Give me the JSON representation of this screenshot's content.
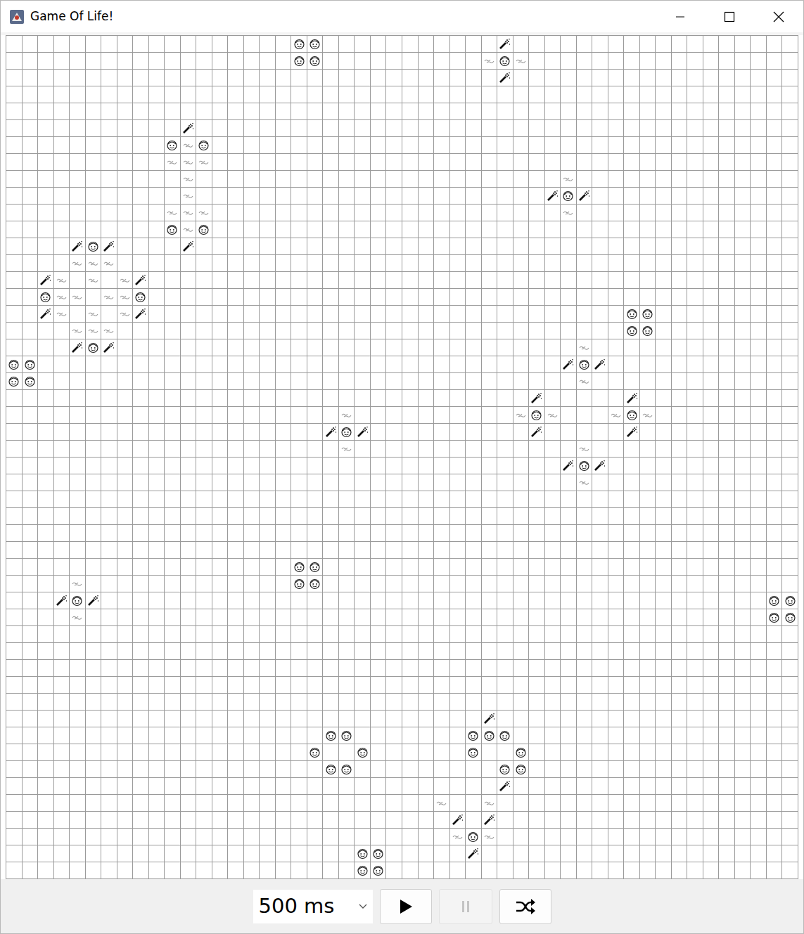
{
  "window": {
    "title": "Game Of Life!"
  },
  "board": {
    "rows": 50,
    "cols": 50,
    "cells": [
      {
        "row": 0,
        "col": 18,
        "kind": "face"
      },
      {
        "row": 0,
        "col": 19,
        "kind": "face"
      },
      {
        "row": 1,
        "col": 18,
        "kind": "face"
      },
      {
        "row": 1,
        "col": 19,
        "kind": "face"
      },
      {
        "row": 0,
        "col": 31,
        "kind": "wand"
      },
      {
        "row": 1,
        "col": 30,
        "kind": "puff"
      },
      {
        "row": 1,
        "col": 31,
        "kind": "face"
      },
      {
        "row": 1,
        "col": 32,
        "kind": "puff"
      },
      {
        "row": 2,
        "col": 31,
        "kind": "wand"
      },
      {
        "row": 5,
        "col": 11,
        "kind": "wand"
      },
      {
        "row": 6,
        "col": 10,
        "kind": "face"
      },
      {
        "row": 6,
        "col": 11,
        "kind": "puff"
      },
      {
        "row": 6,
        "col": 12,
        "kind": "face"
      },
      {
        "row": 7,
        "col": 10,
        "kind": "puff"
      },
      {
        "row": 7,
        "col": 11,
        "kind": "puff"
      },
      {
        "row": 7,
        "col": 12,
        "kind": "puff"
      },
      {
        "row": 8,
        "col": 11,
        "kind": "puff"
      },
      {
        "row": 9,
        "col": 11,
        "kind": "puff"
      },
      {
        "row": 10,
        "col": 10,
        "kind": "puff"
      },
      {
        "row": 10,
        "col": 11,
        "kind": "puff"
      },
      {
        "row": 10,
        "col": 12,
        "kind": "puff"
      },
      {
        "row": 11,
        "col": 10,
        "kind": "face"
      },
      {
        "row": 11,
        "col": 11,
        "kind": "puff"
      },
      {
        "row": 11,
        "col": 12,
        "kind": "face"
      },
      {
        "row": 12,
        "col": 11,
        "kind": "wand"
      },
      {
        "row": 8,
        "col": 35,
        "kind": "puff"
      },
      {
        "row": 9,
        "col": 34,
        "kind": "wand"
      },
      {
        "row": 9,
        "col": 35,
        "kind": "face"
      },
      {
        "row": 9,
        "col": 36,
        "kind": "wand"
      },
      {
        "row": 10,
        "col": 35,
        "kind": "puff"
      },
      {
        "row": 12,
        "col": 4,
        "kind": "wand"
      },
      {
        "row": 12,
        "col": 5,
        "kind": "face"
      },
      {
        "row": 12,
        "col": 6,
        "kind": "wand"
      },
      {
        "row": 13,
        "col": 4,
        "kind": "puff"
      },
      {
        "row": 13,
        "col": 5,
        "kind": "puff"
      },
      {
        "row": 13,
        "col": 6,
        "kind": "puff"
      },
      {
        "row": 14,
        "col": 2,
        "kind": "wand"
      },
      {
        "row": 14,
        "col": 3,
        "kind": "puff"
      },
      {
        "row": 14,
        "col": 5,
        "kind": "puff"
      },
      {
        "row": 14,
        "col": 7,
        "kind": "puff"
      },
      {
        "row": 14,
        "col": 8,
        "kind": "wand"
      },
      {
        "row": 15,
        "col": 2,
        "kind": "face"
      },
      {
        "row": 15,
        "col": 3,
        "kind": "puff"
      },
      {
        "row": 15,
        "col": 4,
        "kind": "puff"
      },
      {
        "row": 15,
        "col": 6,
        "kind": "puff"
      },
      {
        "row": 15,
        "col": 7,
        "kind": "puff"
      },
      {
        "row": 15,
        "col": 8,
        "kind": "face"
      },
      {
        "row": 16,
        "col": 2,
        "kind": "wand"
      },
      {
        "row": 16,
        "col": 3,
        "kind": "puff"
      },
      {
        "row": 16,
        "col": 5,
        "kind": "puff"
      },
      {
        "row": 16,
        "col": 7,
        "kind": "puff"
      },
      {
        "row": 16,
        "col": 8,
        "kind": "wand"
      },
      {
        "row": 17,
        "col": 4,
        "kind": "puff"
      },
      {
        "row": 17,
        "col": 5,
        "kind": "puff"
      },
      {
        "row": 17,
        "col": 6,
        "kind": "puff"
      },
      {
        "row": 18,
        "col": 4,
        "kind": "wand"
      },
      {
        "row": 18,
        "col": 5,
        "kind": "face"
      },
      {
        "row": 18,
        "col": 6,
        "kind": "wand"
      },
      {
        "row": 16,
        "col": 39,
        "kind": "face"
      },
      {
        "row": 16,
        "col": 40,
        "kind": "face"
      },
      {
        "row": 17,
        "col": 39,
        "kind": "face"
      },
      {
        "row": 17,
        "col": 40,
        "kind": "face"
      },
      {
        "row": 18,
        "col": 36,
        "kind": "puff"
      },
      {
        "row": 19,
        "col": 35,
        "kind": "wand"
      },
      {
        "row": 19,
        "col": 36,
        "kind": "face"
      },
      {
        "row": 19,
        "col": 37,
        "kind": "wand"
      },
      {
        "row": 20,
        "col": 36,
        "kind": "puff"
      },
      {
        "row": 19,
        "col": 0,
        "kind": "face"
      },
      {
        "row": 19,
        "col": 1,
        "kind": "face"
      },
      {
        "row": 20,
        "col": 0,
        "kind": "face"
      },
      {
        "row": 20,
        "col": 1,
        "kind": "face"
      },
      {
        "row": 21,
        "col": 33,
        "kind": "wand"
      },
      {
        "row": 22,
        "col": 32,
        "kind": "puff"
      },
      {
        "row": 22,
        "col": 33,
        "kind": "face"
      },
      {
        "row": 22,
        "col": 34,
        "kind": "puff"
      },
      {
        "row": 23,
        "col": 33,
        "kind": "wand"
      },
      {
        "row": 21,
        "col": 39,
        "kind": "wand"
      },
      {
        "row": 22,
        "col": 38,
        "kind": "puff"
      },
      {
        "row": 22,
        "col": 39,
        "kind": "face"
      },
      {
        "row": 22,
        "col": 40,
        "kind": "puff"
      },
      {
        "row": 23,
        "col": 39,
        "kind": "wand"
      },
      {
        "row": 22,
        "col": 21,
        "kind": "puff"
      },
      {
        "row": 23,
        "col": 20,
        "kind": "wand"
      },
      {
        "row": 23,
        "col": 21,
        "kind": "face"
      },
      {
        "row": 23,
        "col": 22,
        "kind": "wand"
      },
      {
        "row": 24,
        "col": 21,
        "kind": "puff"
      },
      {
        "row": 24,
        "col": 36,
        "kind": "puff"
      },
      {
        "row": 25,
        "col": 35,
        "kind": "wand"
      },
      {
        "row": 25,
        "col": 36,
        "kind": "face"
      },
      {
        "row": 25,
        "col": 37,
        "kind": "wand"
      },
      {
        "row": 26,
        "col": 36,
        "kind": "puff"
      },
      {
        "row": 31,
        "col": 18,
        "kind": "face"
      },
      {
        "row": 31,
        "col": 19,
        "kind": "face"
      },
      {
        "row": 32,
        "col": 18,
        "kind": "face"
      },
      {
        "row": 32,
        "col": 19,
        "kind": "face"
      },
      {
        "row": 32,
        "col": 4,
        "kind": "puff"
      },
      {
        "row": 33,
        "col": 3,
        "kind": "wand"
      },
      {
        "row": 33,
        "col": 4,
        "kind": "face"
      },
      {
        "row": 33,
        "col": 5,
        "kind": "wand"
      },
      {
        "row": 34,
        "col": 4,
        "kind": "puff"
      },
      {
        "row": 33,
        "col": 48,
        "kind": "face"
      },
      {
        "row": 33,
        "col": 49,
        "kind": "face"
      },
      {
        "row": 34,
        "col": 48,
        "kind": "face"
      },
      {
        "row": 34,
        "col": 49,
        "kind": "face"
      },
      {
        "row": 41,
        "col": 20,
        "kind": "face"
      },
      {
        "row": 41,
        "col": 21,
        "kind": "face"
      },
      {
        "row": 42,
        "col": 19,
        "kind": "face"
      },
      {
        "row": 42,
        "col": 22,
        "kind": "face"
      },
      {
        "row": 43,
        "col": 20,
        "kind": "face"
      },
      {
        "row": 43,
        "col": 21,
        "kind": "face"
      },
      {
        "row": 40,
        "col": 30,
        "kind": "wand"
      },
      {
        "row": 41,
        "col": 29,
        "kind": "face"
      },
      {
        "row": 41,
        "col": 30,
        "kind": "face"
      },
      {
        "row": 41,
        "col": 31,
        "kind": "face"
      },
      {
        "row": 42,
        "col": 29,
        "kind": "face"
      },
      {
        "row": 42,
        "col": 32,
        "kind": "face"
      },
      {
        "row": 43,
        "col": 31,
        "kind": "face"
      },
      {
        "row": 43,
        "col": 32,
        "kind": "face"
      },
      {
        "row": 44,
        "col": 31,
        "kind": "wand"
      },
      {
        "row": 45,
        "col": 27,
        "kind": "puff"
      },
      {
        "row": 45,
        "col": 30,
        "kind": "puff"
      },
      {
        "row": 46,
        "col": 28,
        "kind": "wand"
      },
      {
        "row": 46,
        "col": 30,
        "kind": "wand"
      },
      {
        "row": 47,
        "col": 28,
        "kind": "puff"
      },
      {
        "row": 47,
        "col": 29,
        "kind": "face"
      },
      {
        "row": 47,
        "col": 30,
        "kind": "puff"
      },
      {
        "row": 48,
        "col": 29,
        "kind": "wand"
      },
      {
        "row": 48,
        "col": 22,
        "kind": "face"
      },
      {
        "row": 48,
        "col": 23,
        "kind": "face"
      },
      {
        "row": 49,
        "col": 22,
        "kind": "face"
      },
      {
        "row": 49,
        "col": 23,
        "kind": "face"
      }
    ]
  },
  "speed": {
    "value": "500 ms"
  },
  "buttons": [
    {
      "kind": "play",
      "disabled": false
    },
    {
      "kind": "pause",
      "disabled": true
    },
    {
      "kind": "shuffle",
      "disabled": false
    }
  ]
}
